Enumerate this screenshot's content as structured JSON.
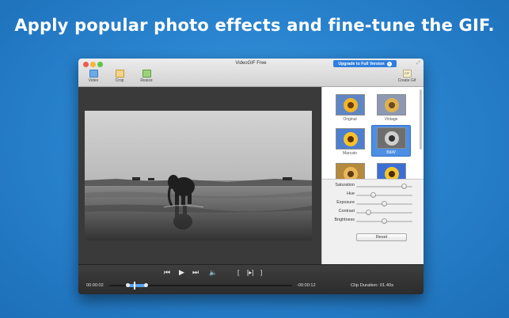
{
  "headline": "Apply popular photo effects and fine-tune the GIF.",
  "window": {
    "title": "VideoGIF Free",
    "upgrade_button": "Upgrade to Full Version",
    "toolbar": {
      "video_label": "Video",
      "crop_label": "Crop",
      "resize_label": "Resize",
      "create_gif_label": "Create Gif",
      "gif_icon_text": "GIF"
    }
  },
  "effects": [
    {
      "name": "Original"
    },
    {
      "name": "Vintage"
    },
    {
      "name": "Marcato"
    },
    {
      "name": "B&W",
      "selected": true
    },
    {
      "name": ""
    },
    {
      "name": ""
    }
  ],
  "adjustments": [
    {
      "label": "Saturation",
      "value": 0.85
    },
    {
      "label": "Hue",
      "value": 0.3
    },
    {
      "label": "Exposure",
      "value": 0.5
    },
    {
      "label": "Contrast",
      "value": 0.22
    },
    {
      "label": "Brightness",
      "value": 0.5
    }
  ],
  "reset_label": "Reset",
  "playback": {
    "current_time": "00:00:02",
    "remaining_time": "-00:00:12",
    "clip_duration": "Clip Duration: 01.40s",
    "progress": 0.14,
    "selection_start": 0.1,
    "selection_end": 0.2
  },
  "colors": {
    "accent": "#4c8fe5",
    "background": "#2a84cf"
  }
}
